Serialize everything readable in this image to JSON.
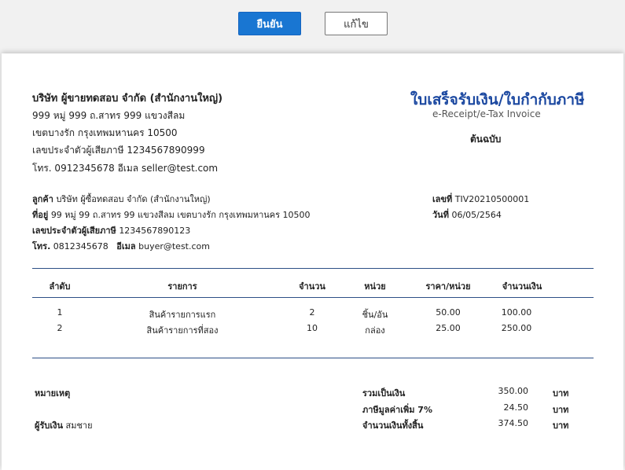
{
  "toolbar": {
    "confirm_label": "ยืนยัน",
    "edit_label": "แก้ไข"
  },
  "seller": {
    "name": "บริษัท ผู้ขายทดสอบ จำกัด (สำนักงานใหญ่)",
    "address1": "999 หมู่ 999 ถ.สาทร 999 แขวงสีลม",
    "address2": "เขตบางรัก  กรุงเทพมหานคร 10500",
    "tax_id": "เลขประจำตัวผู้เสียภาษี 1234567890999",
    "contact": "โทร. 0912345678  อีเมล seller@test.com"
  },
  "doc": {
    "title_th": "ใบเสร็จรับเงิน/ใบกำกับภาษี",
    "title_en": "e-Receipt/e-Tax Invoice",
    "copy_label": "ต้นฉบับ",
    "number_label": "เลขที่",
    "number": "TIV20210500001",
    "date_label": "วันที่",
    "date": "06/05/2564"
  },
  "buyer": {
    "customer_label": "ลูกค้า",
    "customer": "บริษัท ผู้ซื้อทดสอบ จำกัด (สำนักงานใหญ่)",
    "address_label": "ที่อยู่",
    "address": "99 หมู่ 99 ถ.สาทร 99 แขวงสีลม เขตบางรัก กรุงเทพมหานคร 10500",
    "tax_label": "เลขประจำตัวผู้เสียภาษี",
    "tax_id": "1234567890123",
    "phone_label": "โทร.",
    "phone": "0812345678",
    "email_label": "อีเมล",
    "email": "buyer@test.com"
  },
  "table": {
    "headers": [
      "ลำดับ",
      "รายการ",
      "จำนวน",
      "หน่วย",
      "ราคา/หน่วย",
      "จำนวนเงิน"
    ],
    "rows": [
      [
        "1",
        "สินค้ารายการแรก",
        "2",
        "ชิ้น/อัน",
        "50.00",
        "100.00"
      ],
      [
        "2",
        "สินค้ารายการที่สอง",
        "10",
        "กล่อง",
        "25.00",
        "250.00"
      ]
    ]
  },
  "footer": {
    "remark_label": "หมายเหตุ",
    "receiver_label": "ผู้รับเงิน",
    "receiver": "สมชาย",
    "subtotal_label": "รวมเป็นเงิน",
    "subtotal": "350.00",
    "vat_label": "ภาษีมูลค่าเพิ่ม 7%",
    "vat": "24.50",
    "total_label": "จำนวนเงินทั้งสิ้น",
    "total": "374.50",
    "currency": "บาท"
  }
}
